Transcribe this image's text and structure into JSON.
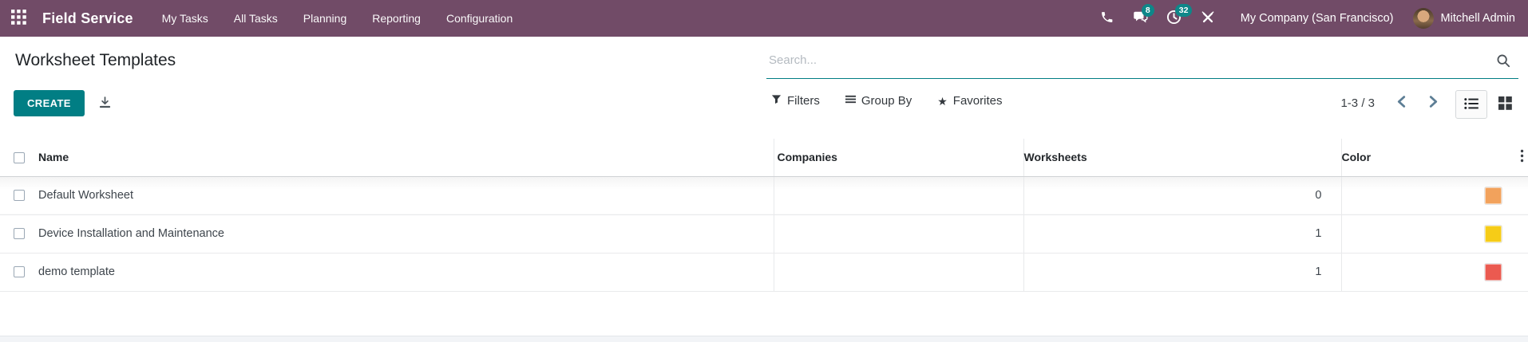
{
  "colors": {
    "brand": "#714B67",
    "primary": "#017E84",
    "badge": "#0E8789"
  },
  "nav": {
    "app_name": "Field Service",
    "menu_items": [
      {
        "label": "My Tasks"
      },
      {
        "label": "All Tasks"
      },
      {
        "label": "Planning"
      },
      {
        "label": "Reporting"
      },
      {
        "label": "Configuration"
      }
    ],
    "messages_badge": "8",
    "activities_badge": "32",
    "company_name": "My Company (San Francisco)",
    "user_name": "Mitchell Admin"
  },
  "control_panel": {
    "title": "Worksheet Templates",
    "create_label": "CREATE",
    "search_placeholder": "Search...",
    "filters_label": "Filters",
    "group_by_label": "Group By",
    "favorites_label": "Favorites",
    "pager_value": "1-3 / 3"
  },
  "table": {
    "headers": {
      "name": "Name",
      "companies": "Companies",
      "worksheets": "Worksheets",
      "color": "Color"
    },
    "rows": [
      {
        "name": "Default Worksheet",
        "companies": "",
        "worksheets": "0",
        "color": "#F2A25C"
      },
      {
        "name": "Device Installation and Maintenance",
        "companies": "",
        "worksheets": "1",
        "color": "#F6CC17"
      },
      {
        "name": "demo template",
        "companies": "",
        "worksheets": "1",
        "color": "#EB5A50"
      }
    ]
  }
}
